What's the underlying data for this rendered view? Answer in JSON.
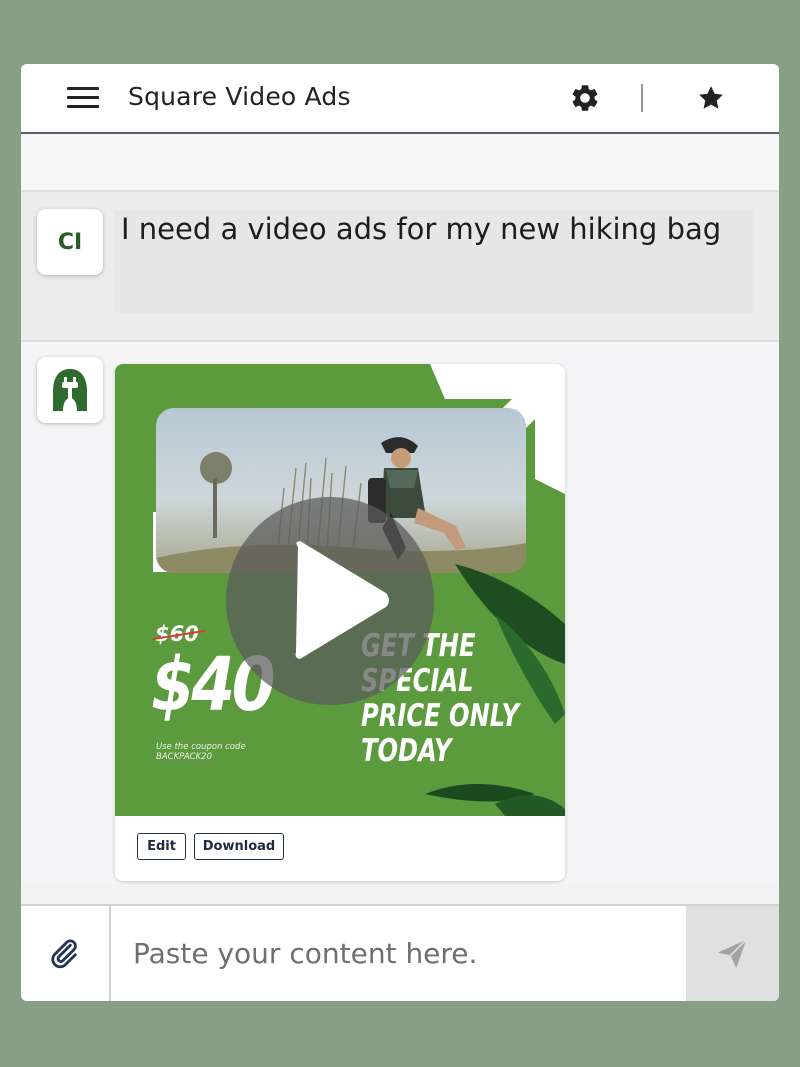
{
  "header": {
    "title": "Square Video Ads",
    "icons": [
      "menu-icon",
      "gear-icon",
      "star-icon"
    ]
  },
  "user_message": {
    "avatar_initials": "CI",
    "text": "I need a video ads for my new hiking bag"
  },
  "bot_message": {
    "avatar_icon": "plug-tree-logo",
    "ad": {
      "old_price": "$60",
      "price": "$40",
      "coupon_line1": "Use the coupon code",
      "coupon_line2": "BACKPACK20",
      "headline": [
        "GET THE",
        "SPECIAL",
        "PRICE ONLY",
        "TODAY"
      ],
      "play_icon": "play-icon",
      "accent_color": "#5c9a3e"
    },
    "actions": {
      "edit_label": "Edit",
      "download_label": "Download"
    }
  },
  "composer": {
    "placeholder": "Paste your content here.",
    "attach_icon": "paperclip-icon",
    "send_icon": "send-icon"
  },
  "colors": {
    "background": "#87a085",
    "brand_green": "#2a5a2a",
    "button_border": "#273048"
  }
}
